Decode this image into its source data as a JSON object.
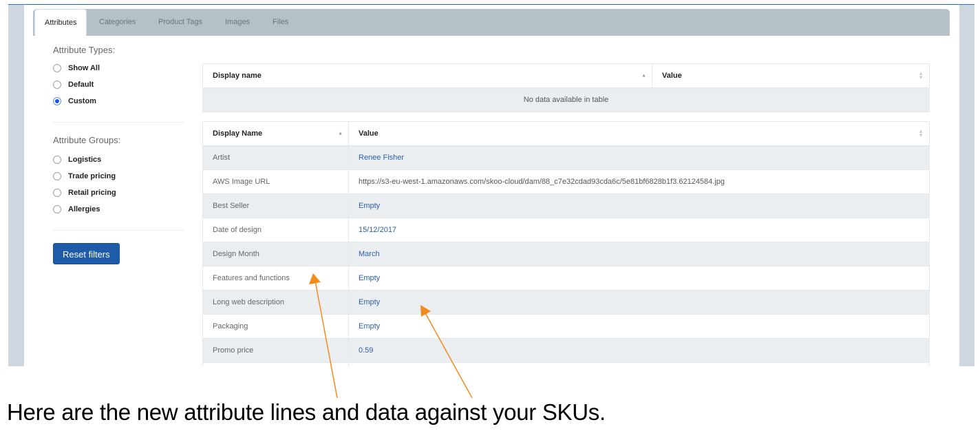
{
  "tabs": [
    {
      "label": "Attributes",
      "active": true
    },
    {
      "label": "Categories",
      "active": false
    },
    {
      "label": "Product Tags",
      "active": false
    },
    {
      "label": "Images",
      "active": false
    },
    {
      "label": "Files",
      "active": false
    }
  ],
  "sidebar": {
    "types_title": "Attribute Types:",
    "types": [
      {
        "label": "Show All",
        "checked": false
      },
      {
        "label": "Default",
        "checked": false
      },
      {
        "label": "Custom",
        "checked": true
      }
    ],
    "groups_title": "Attribute Groups:",
    "groups": [
      {
        "label": "Logistics",
        "checked": false
      },
      {
        "label": "Trade pricing",
        "checked": false
      },
      {
        "label": "Retail pricing",
        "checked": false
      },
      {
        "label": "Allergies",
        "checked": false
      }
    ],
    "reset_label": "Reset filters"
  },
  "table1": {
    "headers": [
      "Display name",
      "Value"
    ],
    "empty_message": "No data available in table"
  },
  "table2": {
    "headers": [
      "Display Name",
      "Value"
    ],
    "rows": [
      {
        "name": "Artist",
        "value": "Renee Fisher"
      },
      {
        "name": "AWS Image URL",
        "value": "https://s3-eu-west-1.amazonaws.com/skoo-cloud/dam/88_c7e32cdad93cda6c/5e81bf6828b1f3.62124584.jpg"
      },
      {
        "name": "Best Seller",
        "value": "Empty"
      },
      {
        "name": "Date of design",
        "value": "15/12/2017"
      },
      {
        "name": "Design Month",
        "value": "March"
      },
      {
        "name": "Features and functions",
        "value": "Empty"
      },
      {
        "name": "Long web description",
        "value": "Empty"
      },
      {
        "name": "Packaging",
        "value": "Empty"
      },
      {
        "name": "Promo price",
        "value": "0.59"
      }
    ]
  },
  "caption": "Here are the new attribute lines and data against your SKUs.",
  "colors": {
    "accent": "#1e5ba8",
    "link": "#2d5ea8",
    "annotation_arrow": "#f28a1c",
    "tabbar": "#b5c1c7",
    "radio_selected": "#1a55f0"
  }
}
